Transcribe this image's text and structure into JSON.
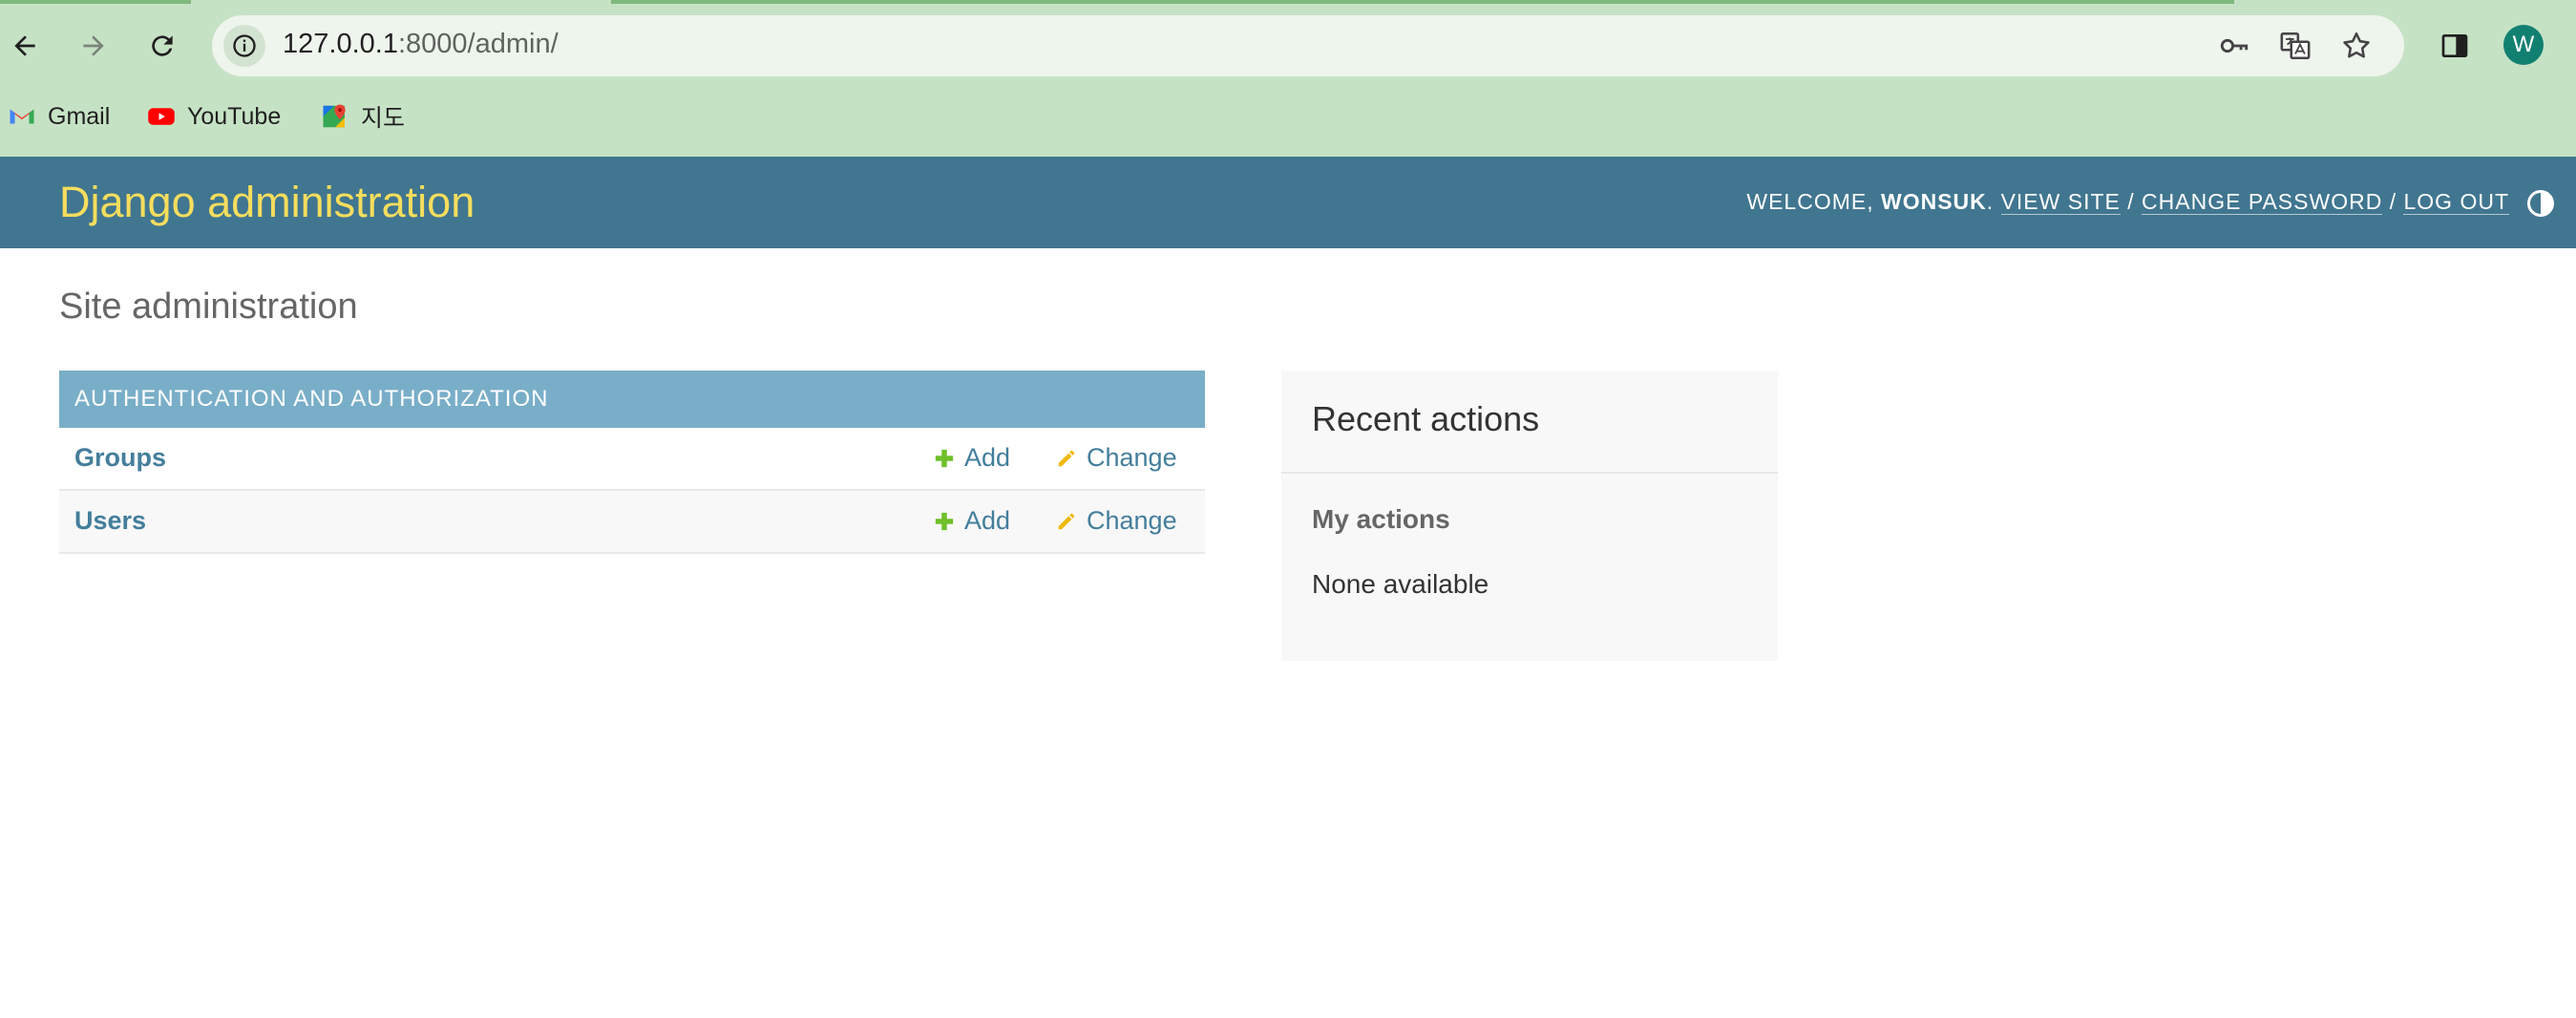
{
  "browser": {
    "url_host": "127.0.0.1",
    "url_rest": ":8000/admin/",
    "profile_initial": "W",
    "bookmarks": [
      {
        "label": "Gmail",
        "icon": "gmail-icon"
      },
      {
        "label": "YouTube",
        "icon": "youtube-icon"
      },
      {
        "label": "지도",
        "icon": "maps-icon"
      }
    ]
  },
  "header": {
    "brand": "Django administration",
    "welcome_prefix": "WELCOME, ",
    "username": "WONSUK",
    "welcome_suffix": ".",
    "view_site": "VIEW SITE",
    "change_password": "CHANGE PASSWORD",
    "log_out": "LOG OUT",
    "separator": " / "
  },
  "content": {
    "title": "Site administration",
    "app": {
      "caption": "AUTHENTICATION AND AUTHORIZATION",
      "models": [
        {
          "name": "Groups",
          "add": "Add",
          "change": "Change"
        },
        {
          "name": "Users",
          "add": "Add",
          "change": "Change"
        }
      ]
    },
    "recent_actions": {
      "title": "Recent actions",
      "subtitle": "My actions",
      "empty": "None available"
    }
  },
  "colors": {
    "header_bg": "#417690",
    "brand": "#f5dd5d",
    "caption_bg": "#79aec8",
    "link": "#447e9b",
    "add_icon": "#70bf2b",
    "change_icon": "#efb80b",
    "chrome_bg": "#c6e2c5"
  }
}
